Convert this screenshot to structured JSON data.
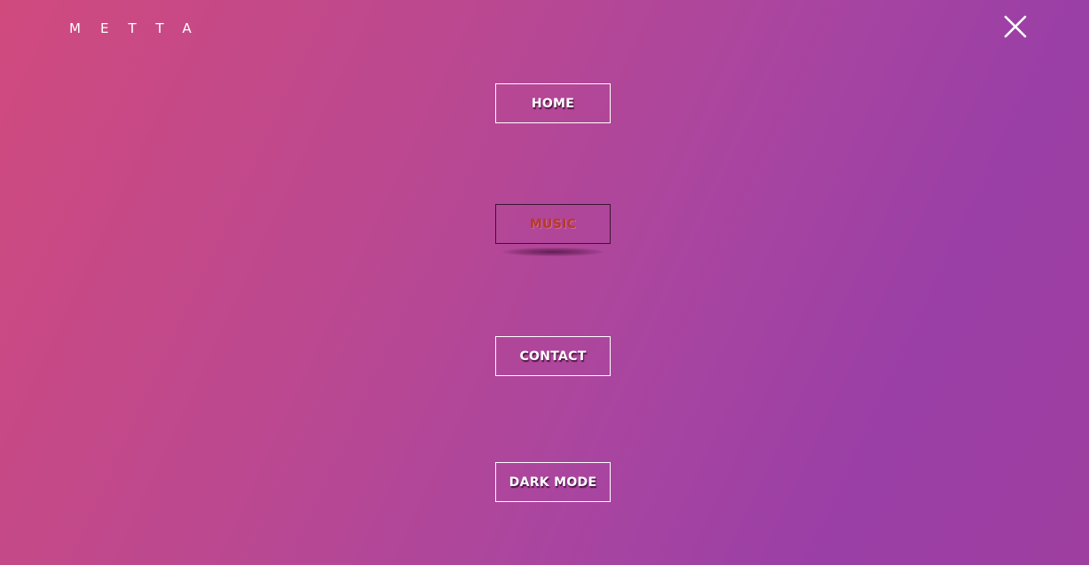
{
  "brand": {
    "logo_text": "METTA"
  },
  "header": {
    "close_icon": "close-icon"
  },
  "menu": {
    "items": [
      {
        "label": "HOME",
        "active": false
      },
      {
        "label": "MUSIC",
        "active": true
      },
      {
        "label": "CONTACT",
        "active": false
      },
      {
        "label": "DARK MODE",
        "active": false
      }
    ]
  },
  "colors": {
    "gradient_start": "#d04a7e",
    "gradient_end": "#9a3fa6",
    "text": "#ffffff",
    "active_text": "#b53a2a",
    "active_border": "#3a1535"
  }
}
